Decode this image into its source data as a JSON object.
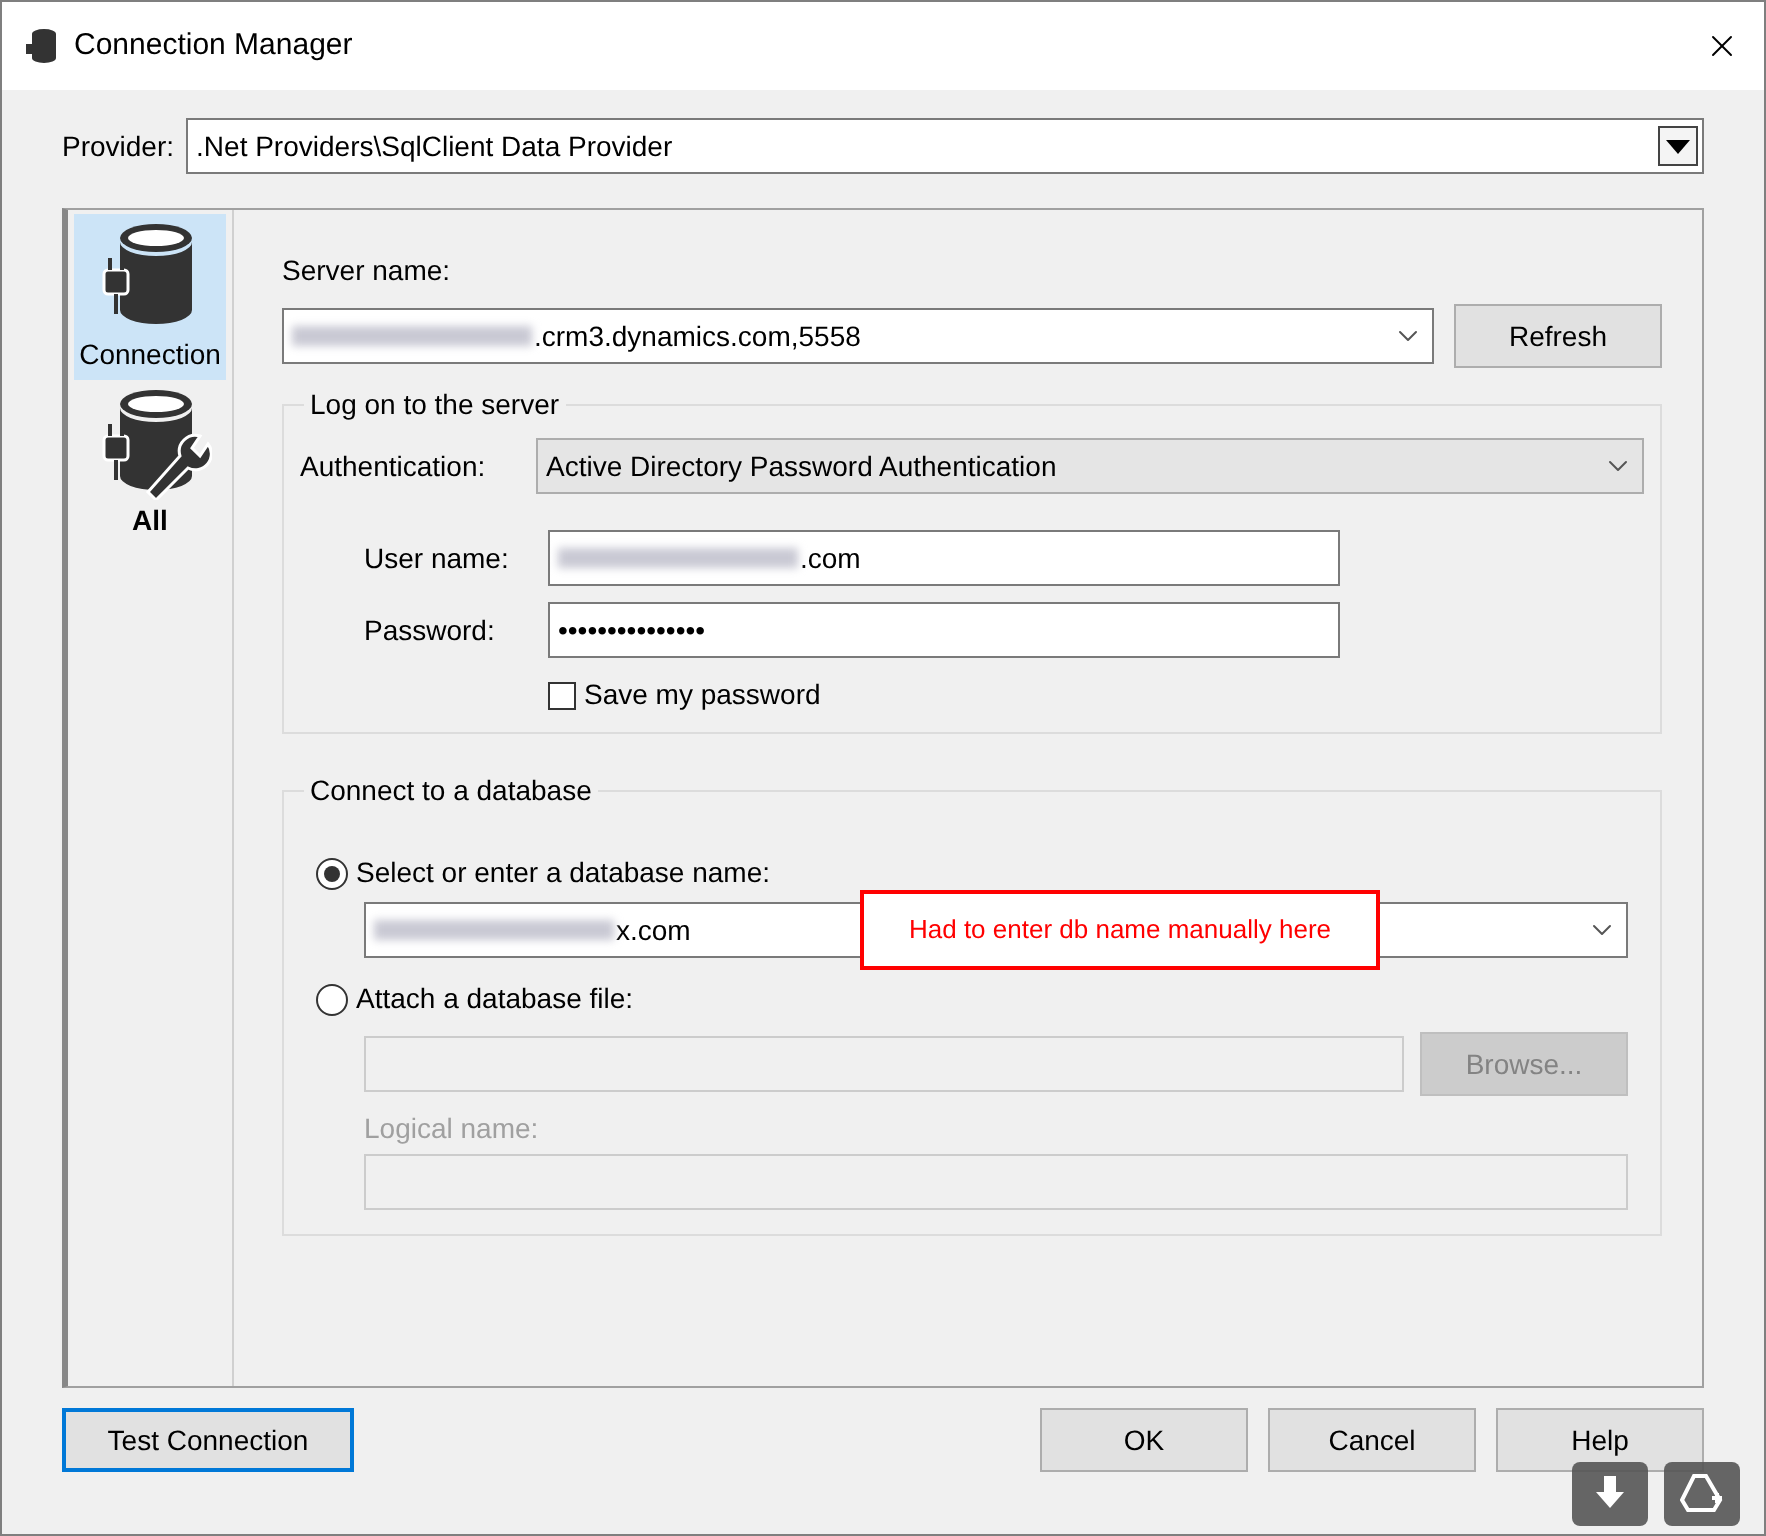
{
  "window": {
    "title": "Connection Manager"
  },
  "provider": {
    "label": "Provider:",
    "value": ".Net Providers\\SqlClient Data Provider"
  },
  "sidebar": {
    "items": [
      {
        "kind": "connection",
        "label": "Connection",
        "selected": true
      },
      {
        "kind": "all",
        "label": "All",
        "selected": false
      }
    ]
  },
  "server": {
    "label": "Server name:",
    "value": ".crm3.dynamics.com,5558",
    "redacted": true,
    "refresh": {
      "label": "Refresh"
    }
  },
  "logon": {
    "title": "Log on to the server",
    "authentication": {
      "label": "Authentication:",
      "value": "Active Directory Password Authentication"
    },
    "user": {
      "label": "User name:",
      "value": ".com",
      "redacted": true
    },
    "password": {
      "label": "Password:",
      "value": "•••••••••••••••"
    },
    "save_password": {
      "label": "Save my password",
      "checked": false
    }
  },
  "database": {
    "title": "Connect to a database",
    "options": [
      {
        "kind": "select",
        "label": "Select or enter a database name:",
        "selected": true,
        "value": "x.com",
        "redacted": true
      },
      {
        "kind": "attach",
        "label": "Attach a database file:",
        "selected": false,
        "browse": {
          "label": "Browse...",
          "disabled": true
        },
        "logical_name": {
          "label": "Logical name:",
          "disabled": true
        }
      }
    ],
    "annotation": {
      "text": "Had to enter db name manually here",
      "color": "#ff0000"
    }
  },
  "buttons": [
    {
      "label": "Test Connection",
      "focused": true
    },
    {
      "label": "OK",
      "focused": false
    },
    {
      "label": "Cancel",
      "focused": false
    },
    {
      "label": "Help",
      "focused": false
    }
  ],
  "overlay_buttons": [
    {
      "kind": "download"
    },
    {
      "kind": "drive"
    }
  ]
}
